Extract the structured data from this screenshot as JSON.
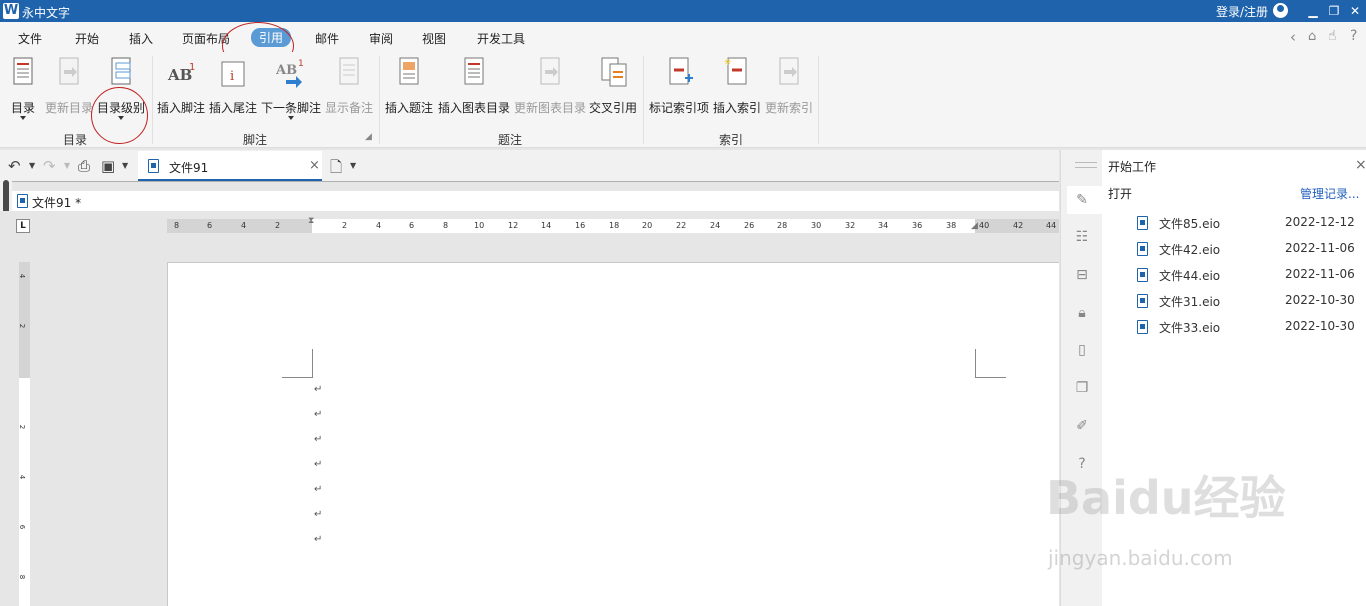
{
  "titlebar": {
    "app_title": "永中文字",
    "login": "登录/注册",
    "logo_letter": "W"
  },
  "menu": [
    "文件",
    "开始",
    "插入",
    "页面布局",
    "引用",
    "邮件",
    "审阅",
    "视图",
    "开发工具"
  ],
  "ribbon": {
    "toc": {
      "toc": "目录",
      "update_toc": "更新目录",
      "toc_level": "目录级别",
      "group": "目录"
    },
    "footnote": {
      "insert_footnote": "插入脚注",
      "insert_endnote": "插入尾注",
      "next_footnote": "下一条脚注",
      "show_notes": "显示备注",
      "group": "脚注"
    },
    "caption": {
      "insert_caption": "插入题注",
      "insert_figure_toc": "插入图表目录",
      "update_figure_toc": "更新图表目录",
      "cross_ref": "交叉引用",
      "group": "题注"
    },
    "index": {
      "mark_index": "标记索引项",
      "insert_index": "插入索引",
      "update_index": "更新索引",
      "group": "索引"
    }
  },
  "doc_tab": {
    "name": "文件91"
  },
  "breadcrumb": {
    "doc": "文件91 *"
  },
  "ruler": {
    "horizontal": [
      "8",
      "6",
      "4",
      "2",
      "2",
      "4",
      "6",
      "8",
      "10",
      "12",
      "14",
      "16",
      "18",
      "20",
      "22",
      "24",
      "26",
      "28",
      "30",
      "32",
      "34",
      "36",
      "38",
      "40",
      "42",
      "44"
    ],
    "vertical": [
      "4",
      "2",
      "2",
      "4",
      "6",
      "8"
    ]
  },
  "side_panel": {
    "title": "开始工作",
    "open_label": "打开",
    "manage": "管理记录...",
    "recent": [
      {
        "name": "文件85.eio",
        "date": "2022-12-12"
      },
      {
        "name": "文件42.eio",
        "date": "2022-11-06"
      },
      {
        "name": "文件44.eio",
        "date": "2022-11-06"
      },
      {
        "name": "文件31.eio",
        "date": "2022-10-30"
      },
      {
        "name": "文件33.eio",
        "date": "2022-10-30"
      }
    ]
  },
  "watermark": {
    "main": "Baidu经验",
    "sub": "jingyan.baidu.com"
  },
  "colors": {
    "title_bar": "#1f63ad",
    "active_tab": "#5b9bd5",
    "annotation": "#c0211f"
  }
}
